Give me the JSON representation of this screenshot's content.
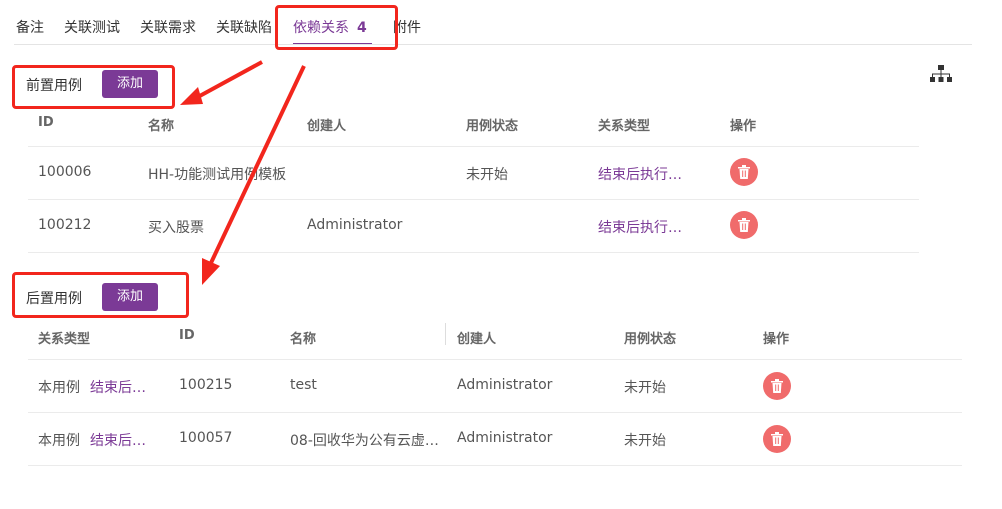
{
  "tabs": [
    {
      "label": "备注"
    },
    {
      "label": "关联测试"
    },
    {
      "label": "关联需求"
    },
    {
      "label": "关联缺陷"
    },
    {
      "label": "依赖关系",
      "count": "4",
      "active": true
    },
    {
      "label": "附件"
    }
  ],
  "pre": {
    "title": "前置用例",
    "add_label": "添加",
    "headers": [
      "ID",
      "名称",
      "创建人",
      "用例状态",
      "关系类型",
      "操作"
    ],
    "rows": [
      {
        "id": "100006",
        "name": "HH-功能测试用例模板",
        "creator": "",
        "status": "未开始",
        "relation": "结束后执行…"
      },
      {
        "id": "100212",
        "name": "买入股票",
        "creator": "Administrator",
        "status": "",
        "relation": "结束后执行…"
      }
    ]
  },
  "post": {
    "title": "后置用例",
    "add_label": "添加",
    "headers": [
      "关系类型",
      "ID",
      "名称",
      "创建人",
      "用例状态",
      "操作"
    ],
    "rows": [
      {
        "self": "本用例",
        "relation": "结束后…",
        "id": "100215",
        "name": "test",
        "creator": "Administrator",
        "status": "未开始"
      },
      {
        "self": "本用例",
        "relation": "结束后…",
        "id": "100057",
        "name": "08-回收华为公有云虚…",
        "creator": "Administrator",
        "status": "未开始"
      }
    ]
  },
  "icons": {
    "tree": "sitemap-icon",
    "delete": "trash-icon"
  },
  "colors": {
    "accent": "#7b3a96",
    "danger": "#f06b6b",
    "annotation": "#f2261d"
  }
}
